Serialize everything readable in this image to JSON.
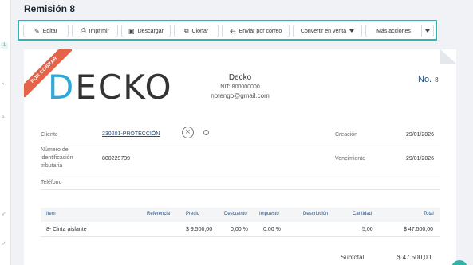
{
  "rail": {
    "badge": "1",
    "marks": [
      "^",
      "s",
      "✓",
      "✓"
    ]
  },
  "title": "Remisión 8",
  "toolbar": {
    "edit": "Editar",
    "print": "Imprimir",
    "download": "Descargar",
    "clone": "Clonar",
    "email": "Enviar por correo",
    "convert": "Convertir en venta",
    "more": "Más acciones"
  },
  "ribbon": "POR COBRAR",
  "logo": {
    "first": "D",
    "rest": "ECKO"
  },
  "company": {
    "name": "Decko",
    "nit": "NIT: 800000000",
    "email": "notengo@gmail.com"
  },
  "doc_number": {
    "prefix": "No.",
    "number": "8"
  },
  "client": {
    "client_label": "Cliente",
    "client_value": "230201-PROTECCIÓN",
    "id_label_1": "Número de",
    "id_label_2": "identificación",
    "id_label_3": "tributaria",
    "id_value": "800229739",
    "phone_label": "Teléfono",
    "created_label": "Creación",
    "created_value": "29/01/2026",
    "due_label": "Vencimiento",
    "due_value": "29/01/2026"
  },
  "table": {
    "headers": [
      "Item",
      "Referencia",
      "Precio",
      "Descuento",
      "Impuesto",
      "Descripción",
      "Cantidad",
      "Total"
    ],
    "rows": [
      {
        "item": "8- Cinta aislante",
        "reference": "",
        "price": "$ 9.500,00",
        "discount": "0,00 %",
        "tax": "0.00 %",
        "description": "",
        "quantity": "5,00",
        "total": "$ 47.500,00"
      }
    ]
  },
  "subtotal": {
    "label": "Subtotal",
    "value": "$ 47.500,00"
  }
}
